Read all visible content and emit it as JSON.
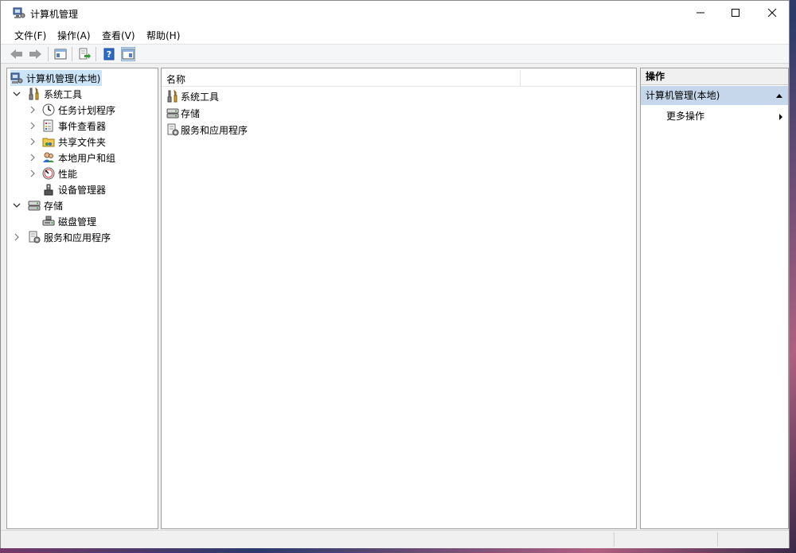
{
  "window": {
    "title": "计算机管理"
  },
  "menubar": {
    "items": [
      {
        "label": "文件(F)"
      },
      {
        "label": "操作(A)"
      },
      {
        "label": "查看(V)"
      },
      {
        "label": "帮助(H)"
      }
    ]
  },
  "tree": {
    "root": "计算机管理(本地)",
    "system_tools": "系统工具",
    "task_scheduler": "任务计划程序",
    "event_viewer": "事件查看器",
    "shared_folders": "共享文件夹",
    "local_users": "本地用户和组",
    "performance": "性能",
    "device_manager": "设备管理器",
    "storage": "存储",
    "disk_management": "磁盘管理",
    "services_apps": "服务和应用程序"
  },
  "list": {
    "column_name": "名称",
    "rows": [
      "系统工具",
      "存储",
      "服务和应用程序"
    ]
  },
  "actions": {
    "header": "操作",
    "section": "计算机管理(本地)",
    "more": "更多操作"
  },
  "colors": {
    "selection": "#c6d7ec",
    "accent": "#2b6cc4"
  }
}
